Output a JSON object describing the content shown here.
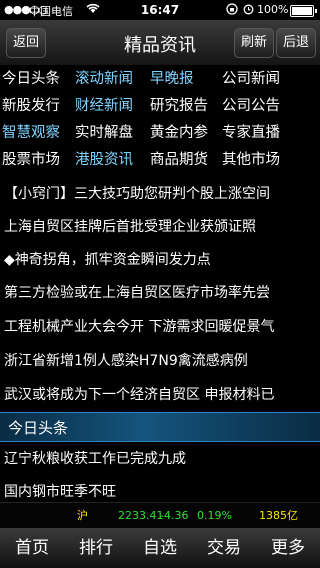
{
  "status": {
    "signal": "●●●○○",
    "carrier": "中国电信",
    "wifi_icon": "wifi-icon",
    "time": "16:47",
    "battery": "100%",
    "battery_level": 1.0
  },
  "nav": {
    "back": "返回",
    "title": "精品资讯",
    "refresh": "刷新",
    "back_right": "后退"
  },
  "categories": [
    "今日头条",
    "滚动新闻",
    "早晚报",
    "公司新闻",
    "新股发行",
    "财经新闻",
    "研究报告",
    "公司公告",
    "智慧观察",
    "实时解盘",
    "黄金内参",
    "专家直播",
    "股票市场",
    "港股资讯",
    "商品期货",
    "其他市场"
  ],
  "news": [
    "【小窍门】三大技巧助您研判个股上涨空间",
    "上海自贸区挂牌后首批受理企业获颁证照",
    "◆神奇拐角，抓牢资金瞬间发力点",
    "第三方检验或在上海自贸区医疗市场率先尝",
    "工程机械产业大会今开 下游需求回暖促景气",
    "浙江省新增1例人感染H7N9禽流感病例",
    "武汉或将成为下一个经济自贸区 申报材料已"
  ],
  "section_title": "今日头条",
  "headlines": [
    "辽宁秋粮收获工作已完成九成",
    "国内钢市旺季不旺"
  ],
  "ticker": {
    "market": "沪",
    "index": "2233.41",
    "change": "-4.36",
    "percent": "0.19%",
    "volume": "1385亿"
  },
  "tabs": [
    "首页",
    "排行",
    "自选",
    "交易",
    "更多"
  ],
  "colors": {
    "category_blue": "#7fd4ff",
    "ticker_green": "#2ee02e",
    "ticker_yellow": "#ffe400",
    "section_blue": "#14547d"
  }
}
